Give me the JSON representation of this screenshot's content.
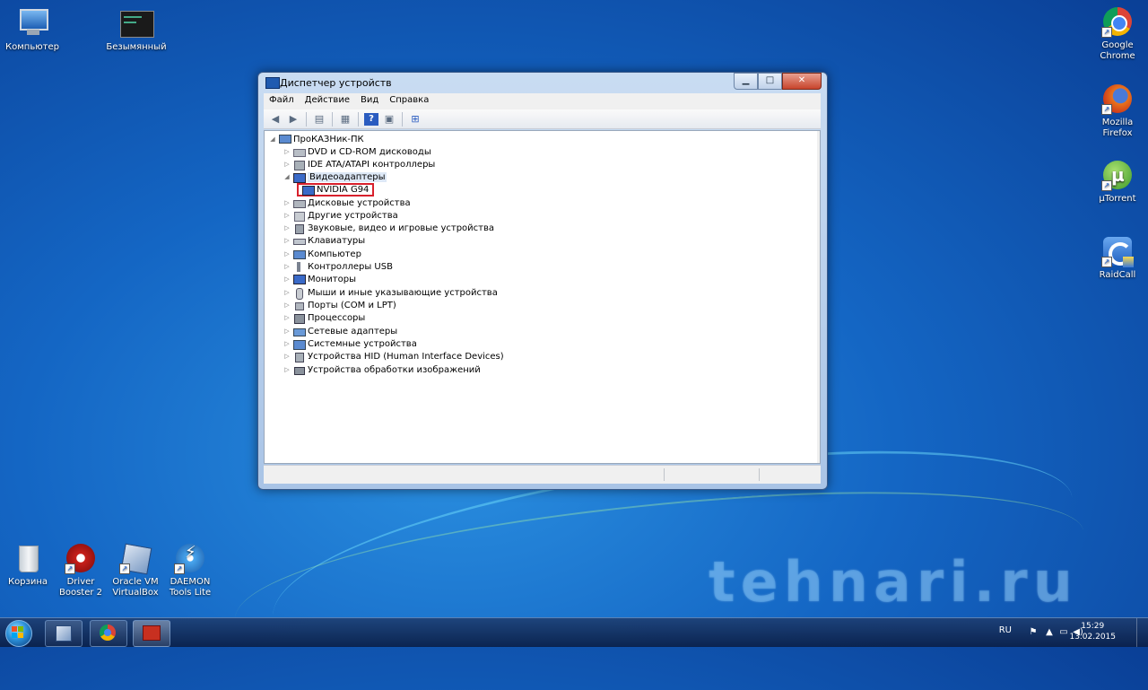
{
  "desktop": {
    "icons_left": [
      {
        "label": "Компьютер"
      },
      {
        "label": "Безымянный"
      }
    ],
    "icons_right": [
      {
        "label_line1": "Google",
        "label_line2": "Chrome"
      },
      {
        "label_line1": "Mozilla",
        "label_line2": "Firefox"
      },
      {
        "label_line1": "µTorrent",
        "label_line2": ""
      },
      {
        "label_line1": "RaidCall",
        "label_line2": ""
      }
    ],
    "icons_bottom": [
      {
        "label_line1": "Корзина",
        "label_line2": ""
      },
      {
        "label_line1": "Driver",
        "label_line2": "Booster 2"
      },
      {
        "label_line1": "Oracle VM",
        "label_line2": "VirtualBox"
      },
      {
        "label_line1": "DAEMON",
        "label_line2": "Tools Lite"
      }
    ],
    "watermark": "tehnari.ru"
  },
  "window": {
    "title": "Диспетчер устройств",
    "buttons": {
      "minimize": "▁",
      "maximize": "□",
      "close": "✕"
    },
    "menu": [
      "Файл",
      "Действие",
      "Вид",
      "Справка"
    ],
    "tree": {
      "root": "ПроКАЗНик-ПК",
      "items": [
        "DVD и CD-ROM дисководы",
        "IDE ATA/ATAPI контроллеры",
        "Видеоадаптеры",
        "NVIDIA G94",
        "Дисковые устройства",
        "Другие устройства",
        "Звуковые, видео и игровые устройства",
        "Клавиатуры",
        "Компьютер",
        "Контроллеры USB",
        "Мониторы",
        "Мыши и иные указывающие устройства",
        "Порты (COM и LPT)",
        "Процессоры",
        "Сетевые адаптеры",
        "Системные устройства",
        "Устройства HID (Human Interface Devices)",
        "Устройства обработки изображений"
      ]
    }
  },
  "taskbar": {
    "language": "RU",
    "time": "15:29",
    "date": "13.02.2015"
  },
  "colors": {
    "highlight_border": "#d8202c",
    "desktop_blue": "#1466c4"
  }
}
